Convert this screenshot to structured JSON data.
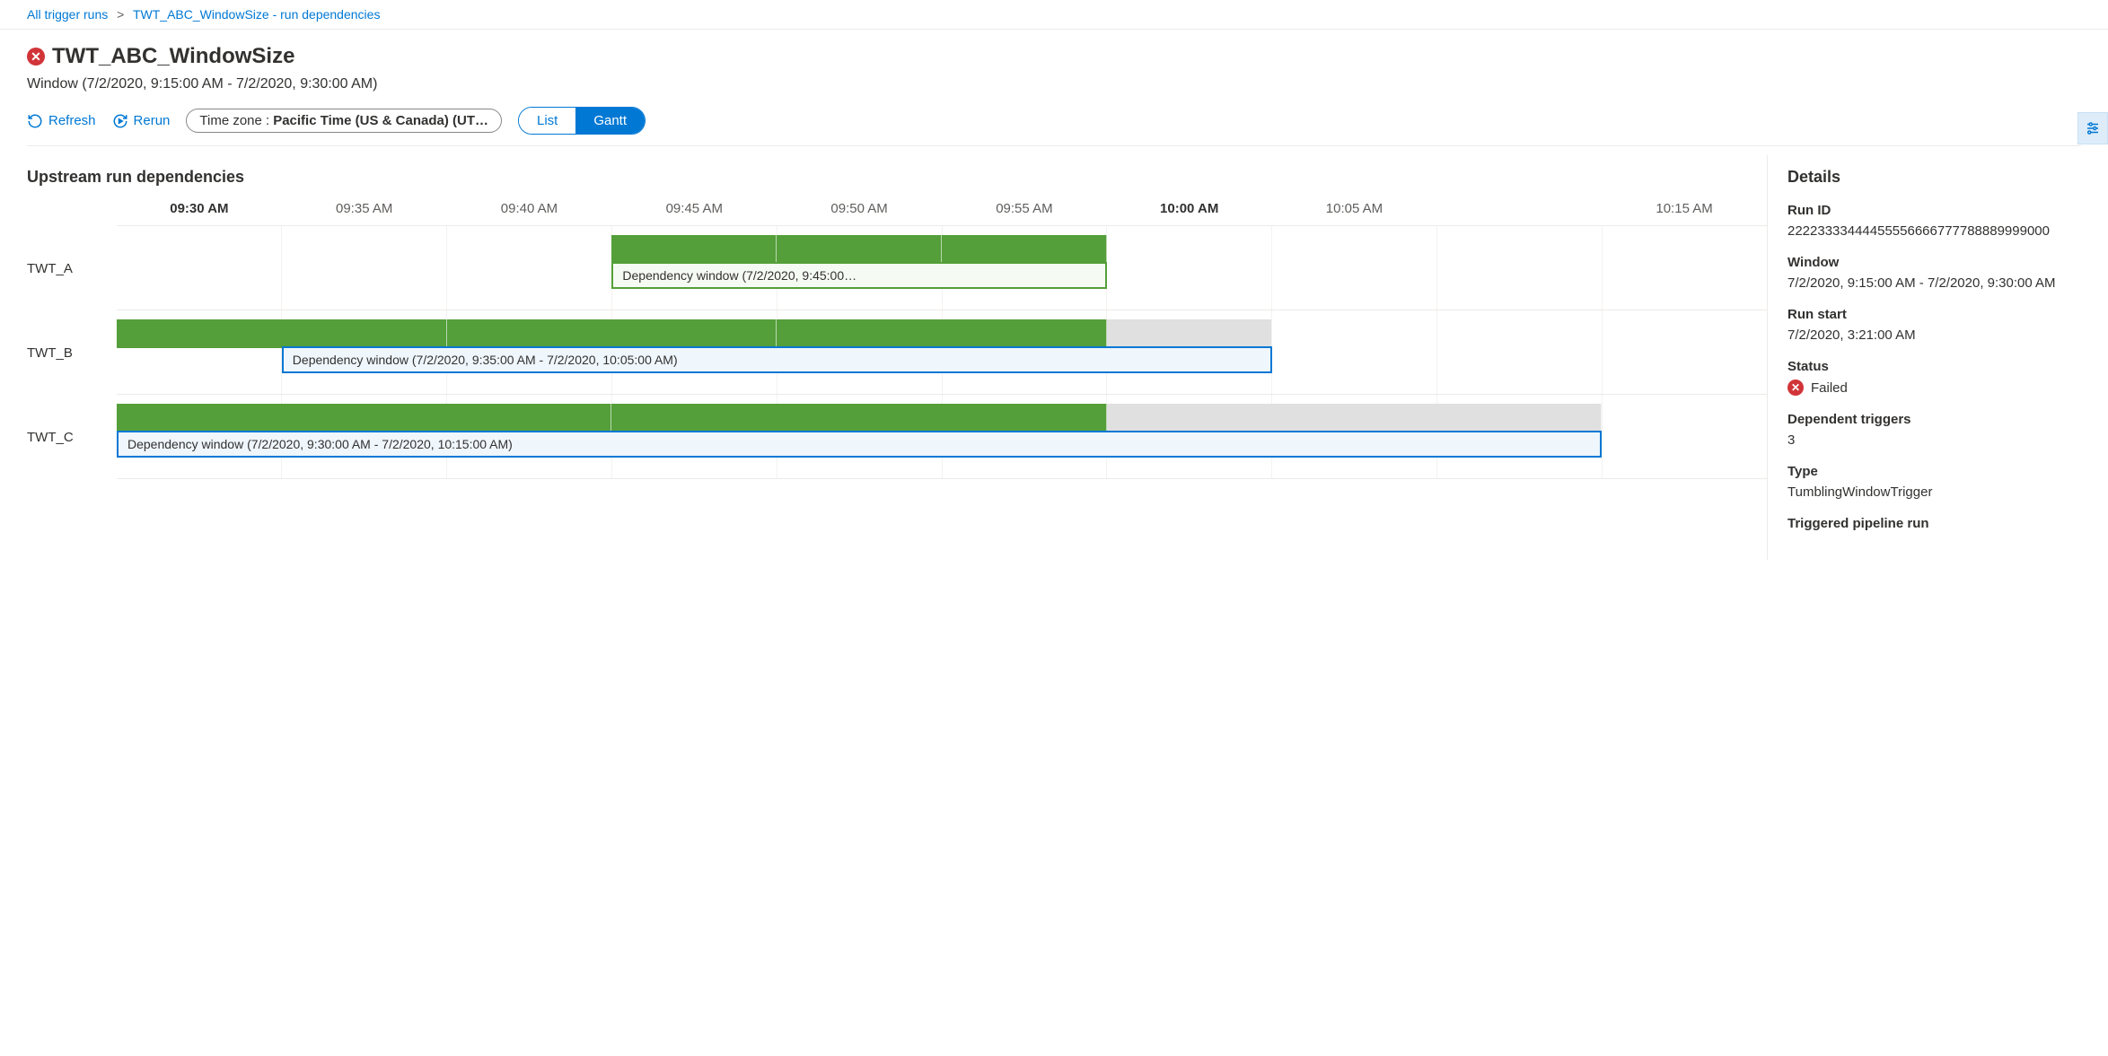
{
  "breadcrumb": {
    "root": "All trigger runs",
    "current": "TWT_ABC_WindowSize - run dependencies"
  },
  "header": {
    "title": "TWT_ABC_WindowSize",
    "window_text": "Window (7/2/2020, 9:15:00 AM - 7/2/2020, 9:30:00 AM)"
  },
  "toolbar": {
    "refresh": "Refresh",
    "rerun": "Rerun",
    "timezone_prefix": "Time zone :",
    "timezone_value": "Pacific Time (US & Canada) (UT…",
    "view_list": "List",
    "view_gantt": "Gantt"
  },
  "gantt": {
    "title": "Upstream run dependencies"
  },
  "details": {
    "heading": "Details",
    "run_id_label": "Run ID",
    "run_id": "22223333444455556666777788889999000",
    "window_label": "Window",
    "window": "7/2/2020, 9:15:00 AM - 7/2/2020, 9:30:00 AM",
    "run_start_label": "Run start",
    "run_start": "7/2/2020, 3:21:00 AM",
    "status_label": "Status",
    "status": "Failed",
    "dep_triggers_label": "Dependent triggers",
    "dep_triggers": "3",
    "type_label": "Type",
    "type": "TumblingWindowTrigger",
    "pipeline_run_label": "Triggered pipeline run"
  },
  "chart_data": {
    "type": "gantt",
    "time_axis": {
      "start": "09:30 AM",
      "end": "10:20 AM",
      "ticks": [
        {
          "label": "09:30 AM",
          "bold": true
        },
        {
          "label": "09:35 AM",
          "bold": false
        },
        {
          "label": "09:40 AM",
          "bold": false
        },
        {
          "label": "09:45 AM",
          "bold": false
        },
        {
          "label": "09:50 AM",
          "bold": false
        },
        {
          "label": "09:55 AM",
          "bold": false
        },
        {
          "label": "10:00 AM",
          "bold": true
        },
        {
          "label": "10:05 AM",
          "bold": false
        },
        {
          "label": "",
          "bold": false
        },
        {
          "label": "10:15 AM",
          "bold": false
        }
      ]
    },
    "rows": [
      {
        "name": "TWT_A",
        "run_segments": [
          {
            "start_pct": 30,
            "width_pct": 10,
            "status": "ok"
          },
          {
            "start_pct": 40,
            "width_pct": 10,
            "status": "ok"
          },
          {
            "start_pct": 50,
            "width_pct": 10,
            "status": "ok"
          }
        ],
        "dependency_window": {
          "label": "Dependency window (7/2/2020, 9:45:00…",
          "start_pct": 30,
          "width_pct": 30,
          "style": "green",
          "range_start": "7/2/2020, 9:45:00 AM"
        }
      },
      {
        "name": "TWT_B",
        "run_segments": [
          {
            "start_pct": 0,
            "width_pct": 20,
            "status": "ok"
          },
          {
            "start_pct": 20,
            "width_pct": 20,
            "status": "ok"
          },
          {
            "start_pct": 40,
            "width_pct": 20,
            "status": "ok"
          },
          {
            "start_pct": 60,
            "width_pct": 10,
            "status": "pending"
          }
        ],
        "dependency_window": {
          "label": "Dependency window (7/2/2020, 9:35:00 AM - 7/2/2020, 10:05:00 AM)",
          "start_pct": 10,
          "width_pct": 60,
          "style": "blue",
          "range_start": "7/2/2020, 9:35:00 AM",
          "range_end": "7/2/2020, 10:05:00 AM"
        }
      },
      {
        "name": "TWT_C",
        "run_segments": [
          {
            "start_pct": 0,
            "width_pct": 30,
            "status": "ok"
          },
          {
            "start_pct": 30,
            "width_pct": 30,
            "status": "ok"
          },
          {
            "start_pct": 60,
            "width_pct": 30,
            "status": "pending"
          }
        ],
        "dependency_window": {
          "label": "Dependency window (7/2/2020, 9:30:00 AM - 7/2/2020, 10:15:00 AM)",
          "start_pct": 0,
          "width_pct": 90,
          "style": "blue",
          "range_start": "7/2/2020, 9:30:00 AM",
          "range_end": "7/2/2020, 10:15:00 AM"
        }
      }
    ]
  }
}
